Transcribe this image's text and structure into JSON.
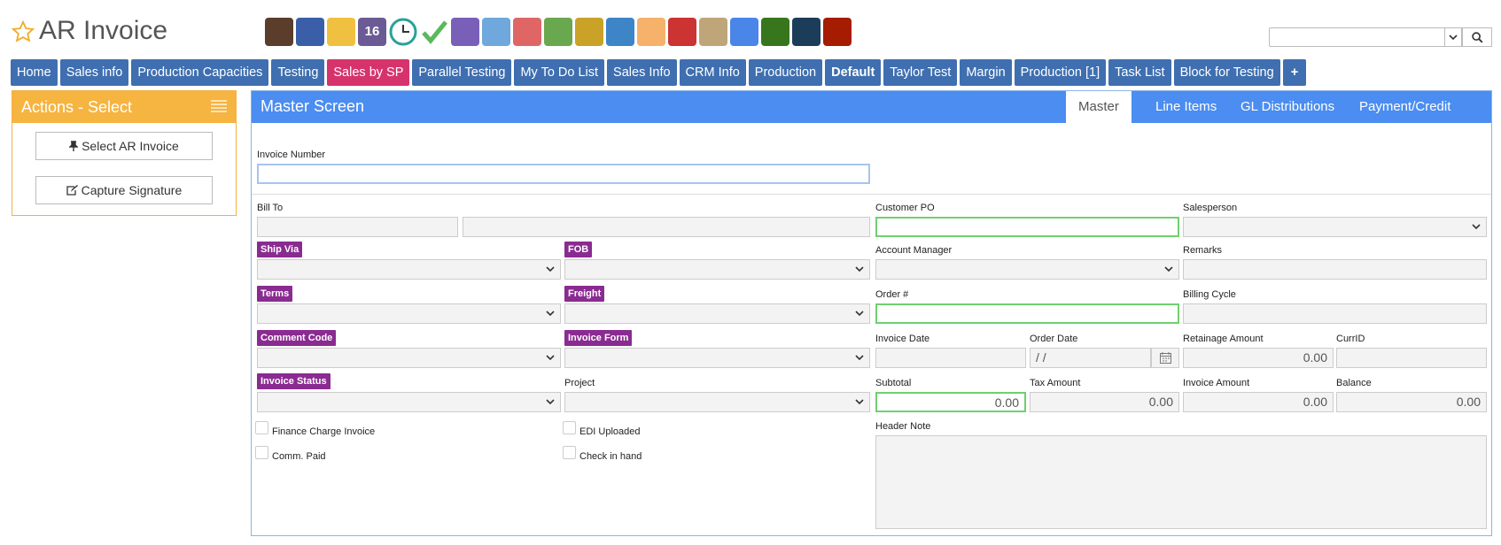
{
  "app": {
    "title": "AR Invoice",
    "accent": "#4b8df0",
    "toolbar_icons": [
      "bank-icon",
      "person-icon",
      "weather-icon",
      "calendar-16-icon",
      "clock-icon",
      "checkmark-icon",
      "keyboard-icon",
      "magnifier-icon",
      "truck-icon",
      "basket-icon",
      "download-box-icon",
      "upload-box-icon",
      "handshake-icon",
      "chat-dollar-icon",
      "clipboard-icon",
      "pencil-icon",
      "money-icon",
      "vault-icon",
      "factory-icon"
    ],
    "calendar_day": "16"
  },
  "search": {
    "value": "",
    "placeholder": ""
  },
  "nav": {
    "tabs": [
      {
        "label": "Home"
      },
      {
        "label": "Sales info"
      },
      {
        "label": "Production Capacities"
      },
      {
        "label": "Testing"
      },
      {
        "label": "Sales by SP",
        "style": "pink"
      },
      {
        "label": "Parallel Testing"
      },
      {
        "label": "My To Do List"
      },
      {
        "label": "Sales Info"
      },
      {
        "label": "CRM Info"
      },
      {
        "label": "Production"
      },
      {
        "label": "Default",
        "style": "bold"
      },
      {
        "label": "Taylor Test"
      },
      {
        "label": "Margin"
      },
      {
        "label": "Production [1]"
      },
      {
        "label": "Task List"
      },
      {
        "label": "Block for Testing"
      },
      {
        "label": "+"
      }
    ]
  },
  "actions": {
    "title": "Actions - Select",
    "buttons": [
      {
        "icon": "pin-icon",
        "label": "Select AR Invoice"
      },
      {
        "icon": "edit-icon",
        "label": "Capture Signature"
      }
    ]
  },
  "master": {
    "title": "Master Screen",
    "tabs": [
      "Master",
      "Line Items",
      "GL Distributions",
      "Payment/Credit History"
    ],
    "active_tab": "Master"
  },
  "form": {
    "invoice_number": {
      "label": "Invoice Number",
      "value": ""
    },
    "bill_to": {
      "label": "Bill To",
      "value1": "",
      "value2": ""
    },
    "customer_po": {
      "label": "Customer PO",
      "value": ""
    },
    "salesperson": {
      "label": "Salesperson",
      "value": ""
    },
    "ship_via": {
      "label": "Ship Via",
      "value": ""
    },
    "fob": {
      "label": "FOB",
      "value": ""
    },
    "account_manager": {
      "label": "Account Manager",
      "value": ""
    },
    "remarks": {
      "label": "Remarks",
      "value": ""
    },
    "terms": {
      "label": "Terms",
      "value": ""
    },
    "freight": {
      "label": "Freight",
      "value": ""
    },
    "order_no": {
      "label": "Order #",
      "value": ""
    },
    "billing_cycle": {
      "label": "Billing Cycle",
      "value": ""
    },
    "comment_code": {
      "label": "Comment Code",
      "value": ""
    },
    "invoice_form": {
      "label": "Invoice Form",
      "value": ""
    },
    "invoice_date": {
      "label": "Invoice Date",
      "value": ""
    },
    "order_date": {
      "label": "Order Date",
      "value": "/ /"
    },
    "retainage_amount": {
      "label": "Retainage Amount",
      "value": "0.00"
    },
    "curr_id": {
      "label": "CurrID",
      "value": ""
    },
    "invoice_status": {
      "label": "Invoice Status",
      "value": ""
    },
    "project": {
      "label": "Project",
      "value": ""
    },
    "subtotal": {
      "label": "Subtotal",
      "value": "0.00"
    },
    "tax_amount": {
      "label": "Tax Amount",
      "value": "0.00"
    },
    "invoice_amount": {
      "label": "Invoice Amount",
      "value": "0.00"
    },
    "balance": {
      "label": "Balance",
      "value": "0.00"
    },
    "finance_charge_invoice": {
      "label": "Finance Charge Invoice",
      "checked": false
    },
    "edi_uploaded": {
      "label": "EDI Uploaded",
      "checked": false
    },
    "comm_paid": {
      "label": "Comm. Paid",
      "checked": false
    },
    "check_in_hand": {
      "label": "Check in hand",
      "checked": false
    },
    "header_note": {
      "label": "Header Note",
      "value": ""
    }
  }
}
